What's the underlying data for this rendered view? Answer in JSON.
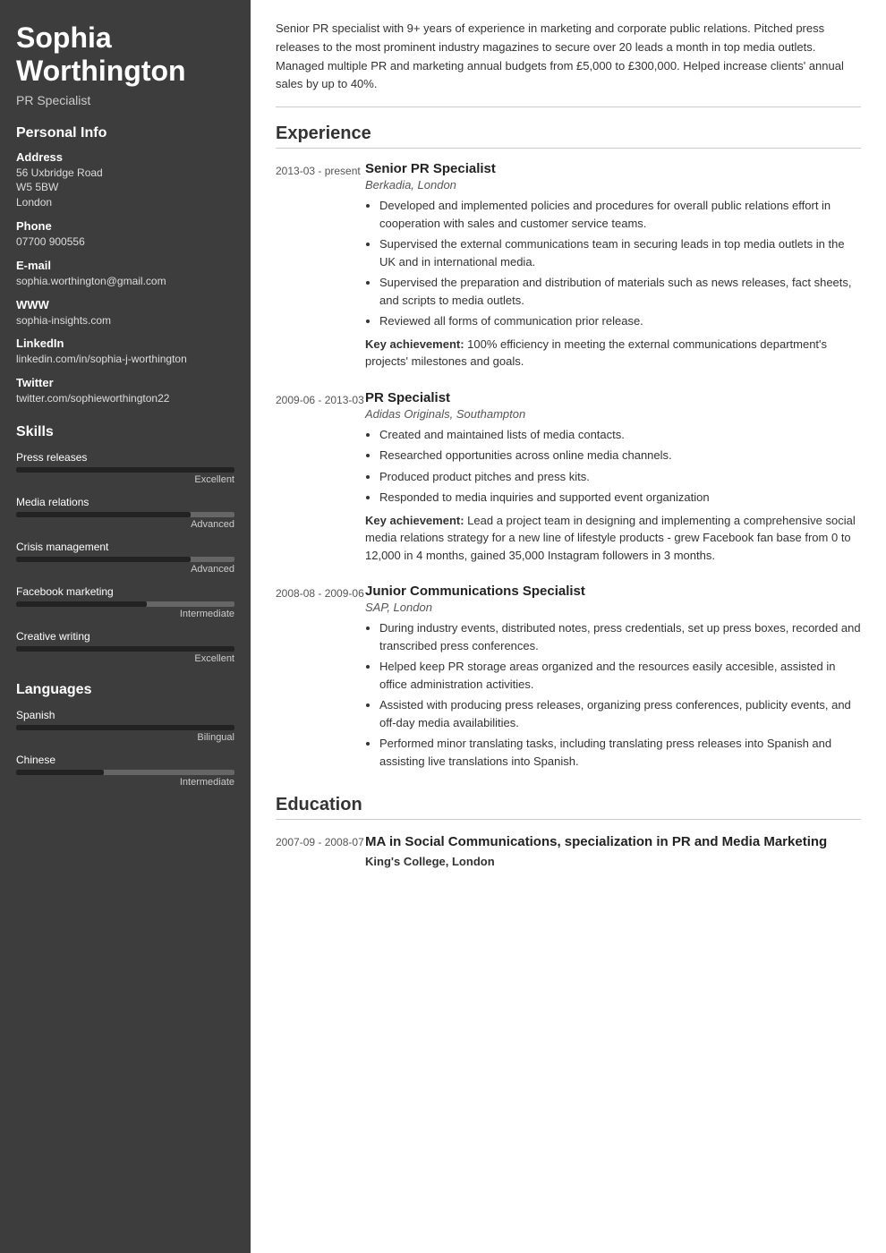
{
  "sidebar": {
    "name_line1": "Sophia",
    "name_line2": "Worthington",
    "subtitle": "PR Specialist",
    "personal_info_heading": "Personal Info",
    "address_label": "Address",
    "address_lines": [
      "56 Uxbridge Road",
      "W5 5BW",
      "London"
    ],
    "phone_label": "Phone",
    "phone_value": "07700 900556",
    "email_label": "E-mail",
    "email_value": "sophia.worthington@gmail.com",
    "www_label": "WWW",
    "www_value": "sophia-insights.com",
    "linkedin_label": "LinkedIn",
    "linkedin_value": "linkedin.com/in/sophia-j-worthington",
    "twitter_label": "Twitter",
    "twitter_value": "twitter.com/sophieworthington22",
    "skills_heading": "Skills",
    "skills": [
      {
        "name": "Press releases",
        "fill_pct": 100,
        "level": "Excellent"
      },
      {
        "name": "Media relations",
        "fill_pct": 80,
        "level": "Advanced"
      },
      {
        "name": "Crisis management",
        "fill_pct": 80,
        "level": "Advanced"
      },
      {
        "name": "Facebook marketing",
        "fill_pct": 60,
        "level": "Intermediate"
      },
      {
        "name": "Creative writing",
        "fill_pct": 100,
        "level": "Excellent"
      }
    ],
    "languages_heading": "Languages",
    "languages": [
      {
        "name": "Spanish",
        "fill_pct": 100,
        "level": "Bilingual"
      },
      {
        "name": "Chinese",
        "fill_pct": 40,
        "level": "Intermediate"
      }
    ]
  },
  "main": {
    "summary": "Senior PR specialist with 9+ years of experience in marketing and corporate public relations. Pitched press releases to the most prominent industry magazines to secure over 20 leads a month in top media outlets. Managed multiple PR and marketing annual budgets from £5,000 to £300,000. Helped increase clients' annual sales by up to 40%.",
    "experience_heading": "Experience",
    "experiences": [
      {
        "date": "2013-03 - present",
        "title": "Senior PR Specialist",
        "company": "Berkadia, London",
        "bullets": [
          "Developed and implemented policies and procedures for overall public relations effort in cooperation with sales and customer service teams.",
          "Supervised the external communications team in securing leads in top media outlets in the UK and in international media.",
          "Supervised the preparation and distribution of materials such as news releases, fact sheets, and scripts to media outlets.",
          "Reviewed all forms of communication prior release."
        ],
        "key_achievement": "Key achievement: 100% efficiency in meeting the external communications department's projects' milestones and goals."
      },
      {
        "date": "2009-06 - 2013-03",
        "title": "PR Specialist",
        "company": "Adidas Originals, Southampton",
        "bullets": [
          "Created and maintained lists of media contacts.",
          "Researched opportunities across online media channels.",
          "Produced product pitches and press kits.",
          "Responded to media inquiries and supported event organization"
        ],
        "key_achievement": "Key achievement: Lead a project team in designing and implementing a comprehensive social media relations strategy for a new line of lifestyle products - grew Facebook fan base from 0 to 12,000 in 4 months, gained 35,000 Instagram followers in 3 months."
      },
      {
        "date": "2008-08 - 2009-06",
        "title": "Junior Communications Specialist",
        "company": "SAP, London",
        "bullets": [
          "During industry events, distributed notes, press credentials, set up press boxes, recorded and transcribed press conferences.",
          "Helped keep PR storage areas organized and the resources easily accesible, assisted in office administration activities.",
          "Assisted with producing press releases, organizing press conferences, publicity events, and off-day media availabilities.",
          "Performed minor translating tasks, including translating press releases into Spanish and assisting live translations into Spanish."
        ],
        "key_achievement": ""
      }
    ],
    "education_heading": "Education",
    "educations": [
      {
        "date": "2007-09 - 2008-07",
        "title": "MA in Social Communications, specialization in PR and Media Marketing",
        "school": "King's College, London"
      }
    ]
  }
}
